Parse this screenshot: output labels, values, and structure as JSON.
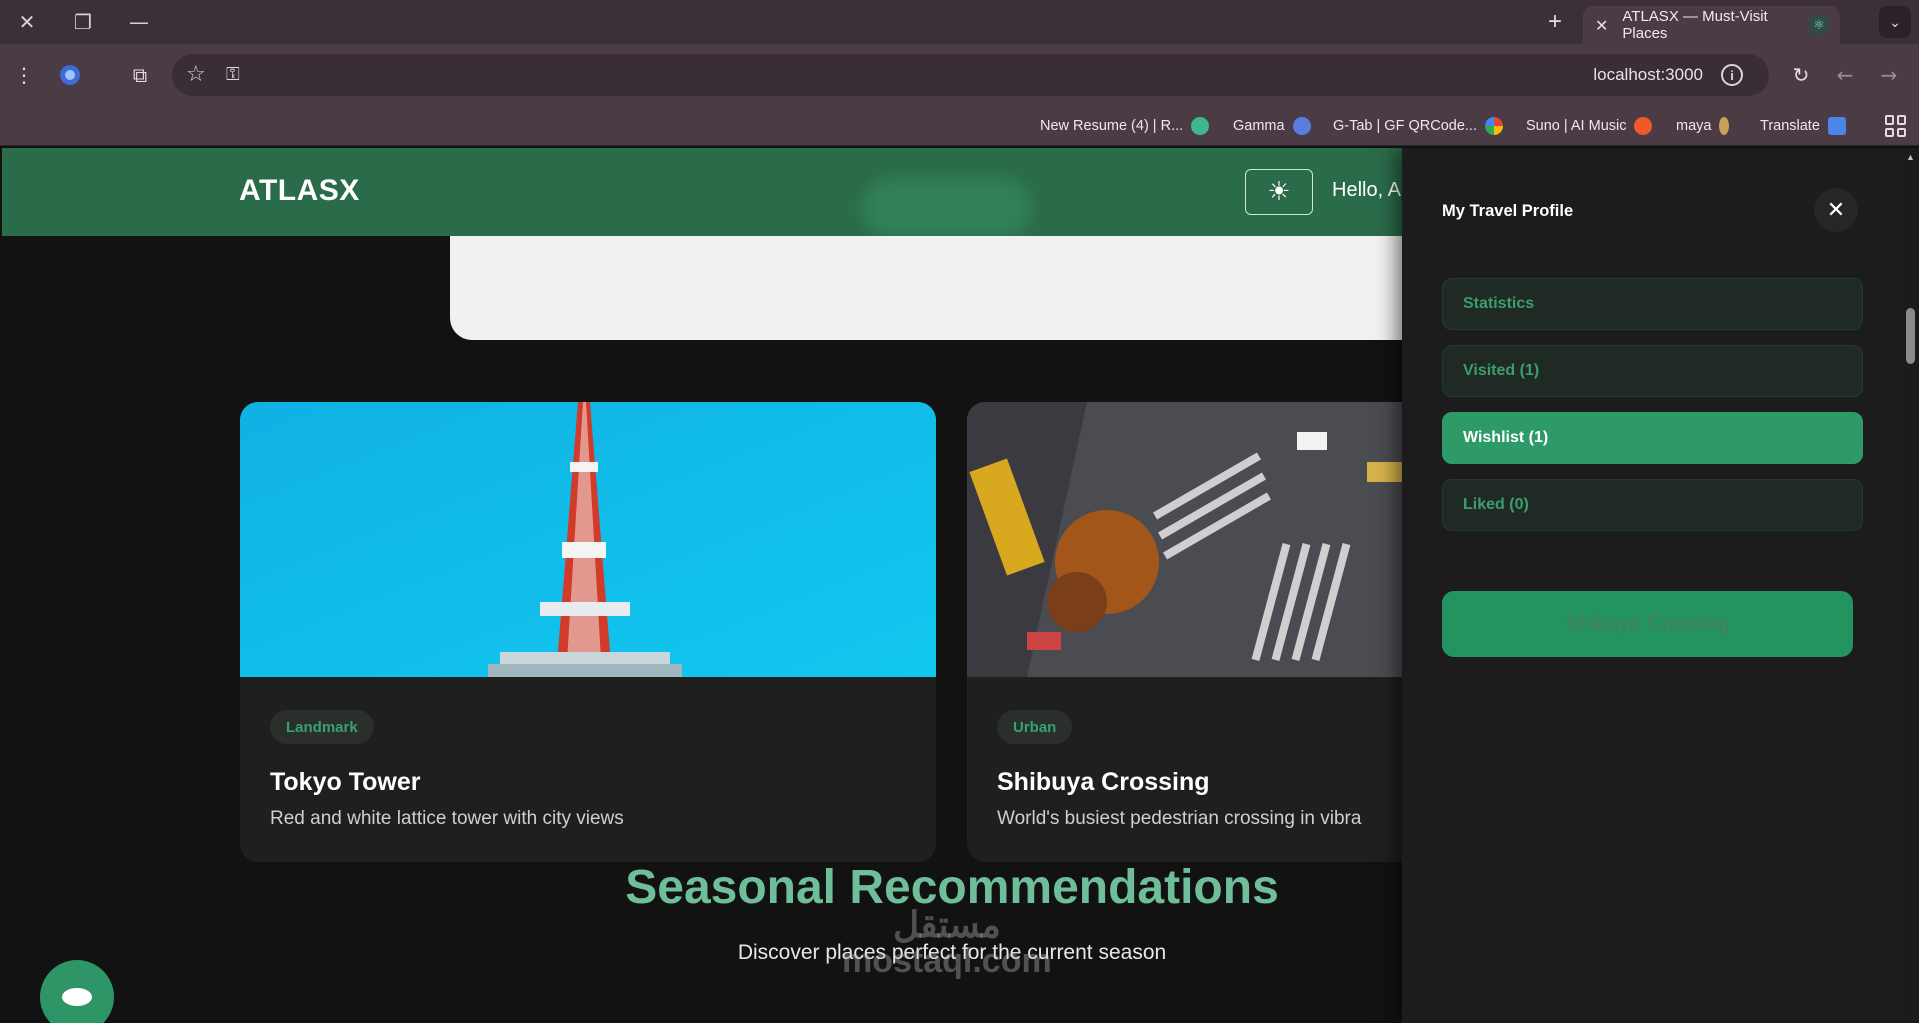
{
  "browser": {
    "tab_title": "ATLASX — Must-Visit Places",
    "url": "localhost:3000",
    "bookmarks": [
      {
        "label": "New Resume (4) | R..."
      },
      {
        "label": "Gamma"
      },
      {
        "label": "G-Tab | GF QRCode..."
      },
      {
        "label": "Suno | AI Music"
      },
      {
        "label": "maya"
      },
      {
        "label": "Translate"
      }
    ]
  },
  "header": {
    "logo": "ATLASX",
    "greeting": "Hello, A"
  },
  "cards": [
    {
      "tag": "Landmark",
      "title": "Tokyo Tower",
      "description": "Red and white lattice tower with city views"
    },
    {
      "tag": "Urban",
      "title": "Shibuya Crossing",
      "description": "World's busiest pedestrian crossing in vibra"
    }
  ],
  "section": {
    "title": "Seasonal Recommendations",
    "subtitle": "Discover places perfect for the current season"
  },
  "watermark": {
    "line1": "مستقل",
    "line2": "mostaql.com"
  },
  "profile_panel": {
    "title": "My Travel Profile",
    "tabs": [
      {
        "label": "Statistics",
        "active": false
      },
      {
        "label": "Visited (1)",
        "active": false
      },
      {
        "label": "Wishlist (1)",
        "active": true
      },
      {
        "label": "Liked (0)",
        "active": false
      }
    ],
    "wishlist_items": [
      "Shibuya Crossing"
    ]
  },
  "colors": {
    "header_green": "#2a6b4a",
    "accent_green": "#2e9a68",
    "section_title": "#6fbe9a"
  }
}
